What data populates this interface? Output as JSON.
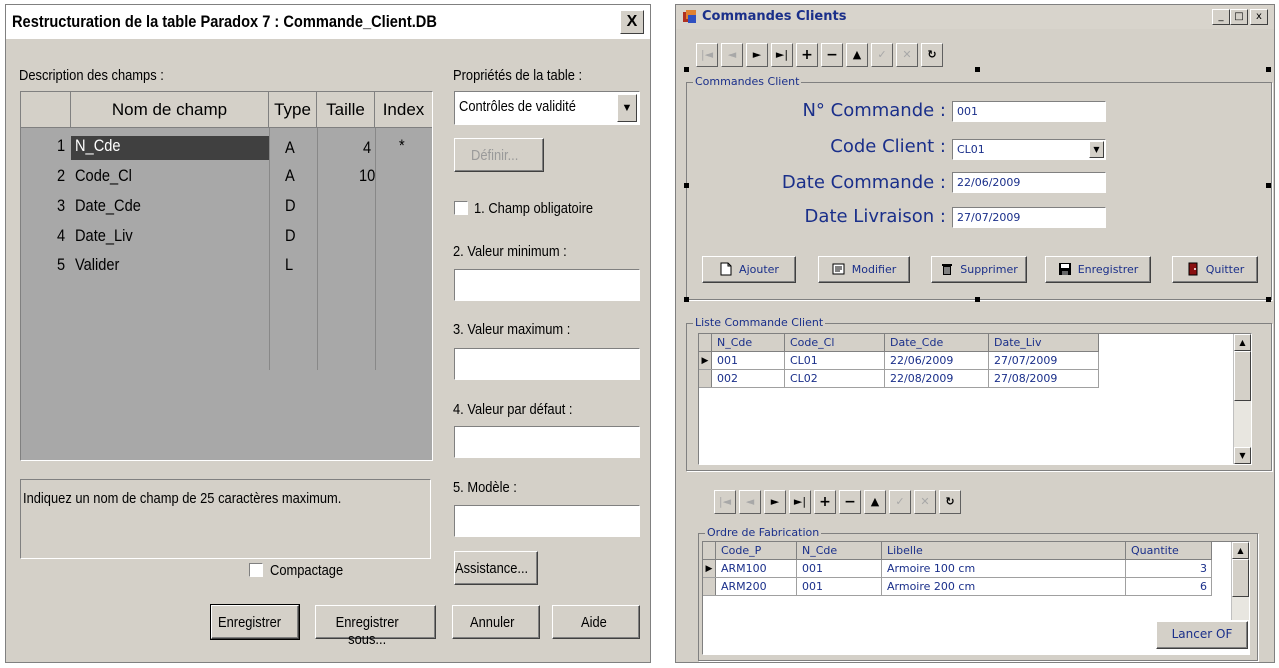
{
  "left_window": {
    "title": "Restructuration de la table Paradox 7 : Commande_Client.DB",
    "close_glyph": "X",
    "fields_label": "Description des champs :",
    "columns": [
      "Nom de champ",
      "Type",
      "Taille",
      "Index"
    ],
    "rows": [
      {
        "num": "1",
        "name": "N_Cde",
        "type": "A",
        "size": "4",
        "index": "*"
      },
      {
        "num": "2",
        "name": "Code_Cl",
        "type": "A",
        "size": "10",
        "index": ""
      },
      {
        "num": "3",
        "name": "Date_Cde",
        "type": "D",
        "size": "",
        "index": ""
      },
      {
        "num": "4",
        "name": "Date_Liv",
        "type": "D",
        "size": "",
        "index": ""
      },
      {
        "num": "5",
        "name": "Valider",
        "type": "L",
        "size": "",
        "index": ""
      }
    ],
    "hint": "Indiquez un nom de champ de 25 caractères maximum.",
    "compact_label": "Compactage",
    "props_label": "Propriétés de la table :",
    "props_select": "Contrôles de validité",
    "define_button": "Définir...",
    "required_label": "1. Champ obligatoire",
    "min_label": "2. Valeur minimum :",
    "max_label": "3. Valeur maximum :",
    "default_label": "4. Valeur par défaut :",
    "model_label": "5. Modèle :",
    "assist_button": "Assistance...",
    "save_button": "Enregistrer",
    "save_as_button": "Enregistrer sous...",
    "cancel_button": "Annuler",
    "help_button": "Aide"
  },
  "right_window": {
    "title": "Commandes Clients",
    "caption_buttons": [
      "_",
      "□",
      "x"
    ],
    "nav_glyphs": [
      "|◄",
      "◄",
      "►",
      "►|",
      "+",
      "−",
      "▲",
      "✓",
      "✕",
      "↻"
    ],
    "group1_caption": "Commandes Client",
    "fields": [
      {
        "label": "N° Commande :",
        "value": "001"
      },
      {
        "label": "Code Client :",
        "value": "CL01"
      },
      {
        "label": "Date Commande :",
        "value": "22/06/2009"
      },
      {
        "label": "Date Livraison :",
        "value": "27/07/2009"
      }
    ],
    "actions": [
      "Ajouter",
      "Modifier",
      "Supprimer",
      "Enregistrer",
      "Quitter"
    ],
    "list_caption": "Liste Commande Client",
    "list_columns": [
      "N_Cde",
      "Code_Cl",
      "Date_Cde",
      "Date_Liv"
    ],
    "list_rows": [
      [
        "001",
        "CL01",
        "22/06/2009",
        "27/07/2009"
      ],
      [
        "002",
        "CL02",
        "22/08/2009",
        "27/08/2009"
      ]
    ],
    "of_caption": "Ordre de Fabrication",
    "of_columns": [
      "Code_P",
      "N_Cde",
      "Libelle",
      "Quantite"
    ],
    "of_rows": [
      [
        "ARM100",
        "001",
        "Armoire 100 cm",
        "3"
      ],
      [
        "ARM200",
        "001",
        "Armoire 200 cm",
        "6"
      ]
    ],
    "launch_button": "Lancer OF",
    "colors": {
      "label_blue": "#1a2f8a",
      "face": "#d4d0c8"
    }
  }
}
